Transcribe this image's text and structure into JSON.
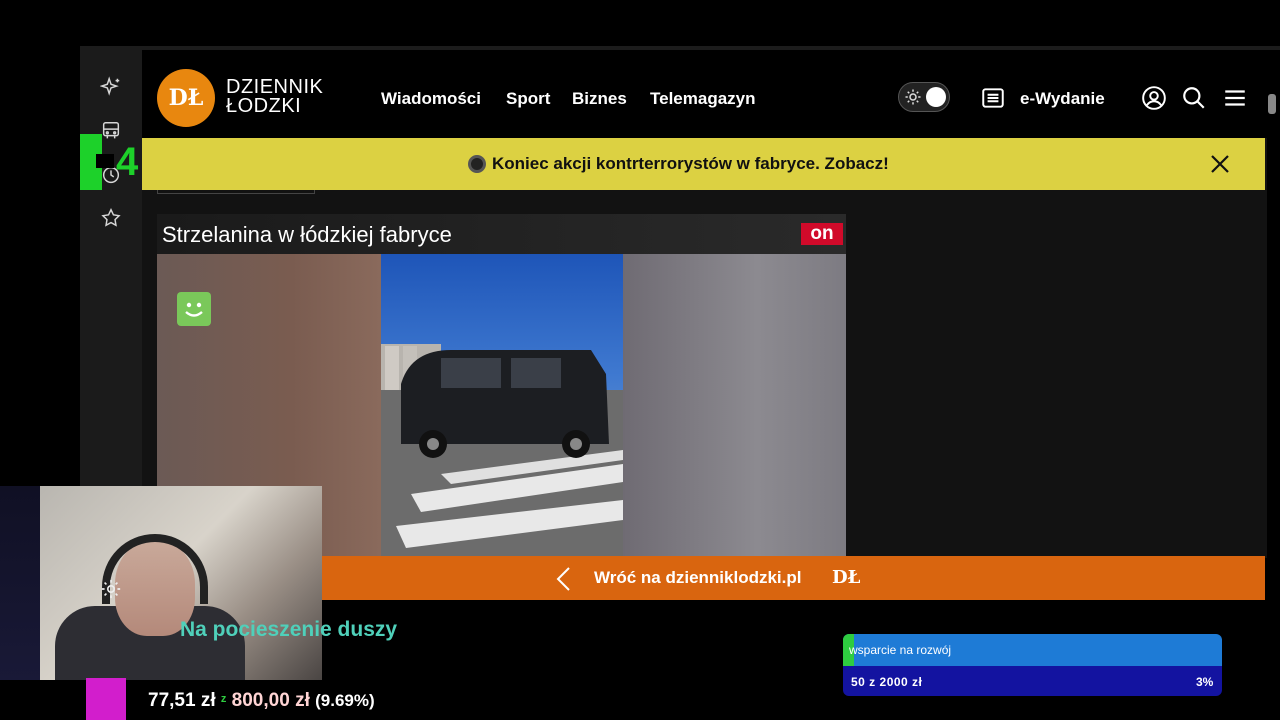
{
  "site": {
    "logo_text": "DŁ",
    "brand_line1": "DZIENNIK",
    "brand_line2": "ŁODZKI",
    "nav": [
      "Wiadomości",
      "Sport",
      "Biznes",
      "Telemagazyn"
    ],
    "edition_label": "e-Wydanie"
  },
  "alert": {
    "text": "Koniec akcji kontrterrorystów w fabryce. Zobacz!"
  },
  "video": {
    "title": "Strzelanina w łódzkiej fabryce",
    "badge": "on"
  },
  "back_bar": {
    "text": "Wróć na dzienniklodzki.pl",
    "logo": "DŁ"
  },
  "stream": {
    "caption": "Na pocieszenie duszy",
    "donation_current": "77,51 zł",
    "donation_target": "800,00 zł",
    "donation_percent": "(9.69%)",
    "overlay_digit": "4"
  },
  "goal": {
    "label": "wsparcie na rozwój",
    "amounts": "50 z 2000 zł",
    "percent": "3%",
    "progress": 0.03
  },
  "colors": {
    "logo_orange": "#e8870f",
    "alert_yellow": "#dcd142",
    "back_orange": "#d9650f",
    "badge_red": "#d10a2a",
    "caption_teal": "#4fd0ba",
    "goal_blue": "#1e7bd6",
    "goal_dark_blue": "#1313a0",
    "goal_green": "#2ecc40"
  },
  "icons": {
    "rail": [
      "sparkle-star-icon",
      "bus-icon",
      "history-clock-icon",
      "favorite-star-icon"
    ],
    "header": [
      "theme-toggle",
      "newspaper-icon",
      "user-account-icon",
      "search-icon",
      "menu-icon"
    ],
    "alert": [
      "close-icon"
    ],
    "back": [
      "chevron-left-icon"
    ],
    "webcam": [
      "settings-gear-icon"
    ]
  }
}
